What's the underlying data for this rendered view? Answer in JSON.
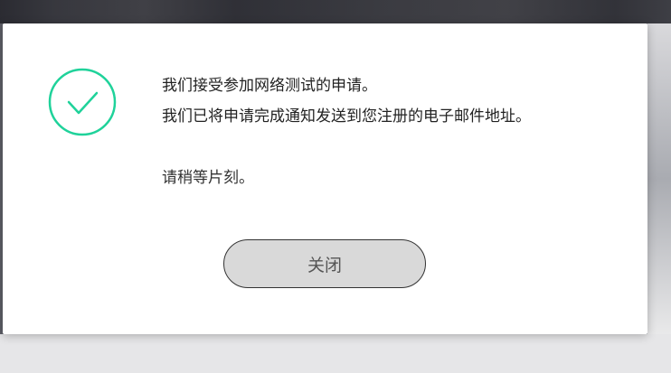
{
  "dialog": {
    "icon": "check-circle-icon",
    "accent_color": "#1fd29a",
    "messages": [
      "我们接受参加网络测试的申请。",
      "我们已将申请完成通知发送到您注册的电子邮件地址。"
    ],
    "wait_text": "请稍等片刻。",
    "close_label": "关闭"
  }
}
